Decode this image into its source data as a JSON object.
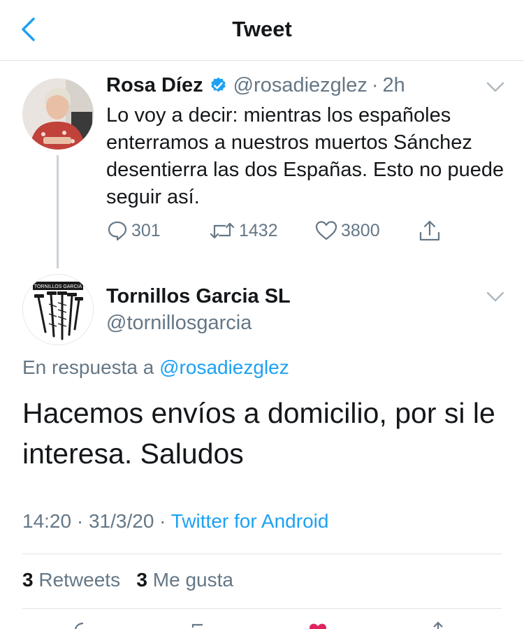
{
  "header": {
    "title": "Tweet",
    "back_icon": "chevron-left-icon"
  },
  "original_tweet": {
    "author_name": "Rosa Díez",
    "verified": true,
    "handle": "@rosadiezglez",
    "separator": "·",
    "time": "2h",
    "text": "Lo voy a decir: mientras los españoles enterramos a nuestros muertos Sánchez desentierra las dos Españas. Esto no puede seguir así.",
    "replies": "301",
    "retweets": "1432",
    "likes": "3800"
  },
  "reply_tweet": {
    "author_name": "Tornillos Garcia SL",
    "handle": "@tornillosgarcia",
    "avatar_label": "TORNILLOS GARCIA",
    "reply_prefix": "En respuesta a",
    "reply_handle": "@rosadiezglez",
    "text": "Hacemos envíos a domicilio, por si le interesa. Saludos",
    "time": "14:20",
    "dot": "·",
    "date": "31/3/20",
    "source": "Twitter for Android"
  },
  "stats": {
    "retweets_count": "3",
    "retweets_label": "Retweets",
    "likes_count": "3",
    "likes_label": "Me gusta"
  },
  "colors": {
    "accent": "#1da1f2",
    "muted": "#657786",
    "text": "#14171a",
    "like": "#e0245e"
  }
}
